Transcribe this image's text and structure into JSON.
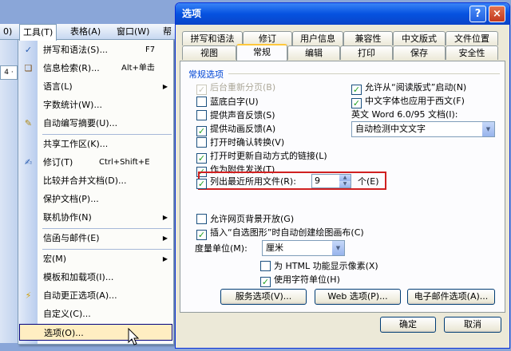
{
  "word": {
    "menubar": [
      {
        "label": "0)"
      },
      {
        "label": "工具(T)"
      },
      {
        "label": "表格(A)"
      },
      {
        "label": "窗口(W)"
      },
      {
        "label": "帮"
      }
    ],
    "toolbar_box": "4 ·"
  },
  "tools_menu": {
    "items": [
      {
        "label": "拼写和语法(S)...",
        "shortcut": "F7",
        "icon": "spelling-icon"
      },
      {
        "label": "信息检索(R)...",
        "shortcut": "Alt+单击",
        "icon": "research-icon"
      },
      {
        "label": "语言(L)",
        "submenu": true
      },
      {
        "label": "字数统计(W)..."
      },
      {
        "label": "自动编写摘要(U)...",
        "icon": "autosummarize-icon"
      },
      {
        "label": "共享工作区(K)..."
      },
      {
        "label": "修订(T)",
        "shortcut": "Ctrl+Shift+E",
        "icon": "track-changes-icon"
      },
      {
        "label": "比较并合并文档(D)..."
      },
      {
        "label": "保护文档(P)..."
      },
      {
        "label": "联机协作(N)",
        "submenu": true
      },
      {
        "label": "信函与邮件(E)",
        "submenu": true
      },
      {
        "label": "宏(M)",
        "submenu": true
      },
      {
        "label": "模板和加载项(I)..."
      },
      {
        "label": "自动更正选项(A)...",
        "icon": "autocorrect-icon"
      },
      {
        "label": "自定义(C)..."
      },
      {
        "label": "选项(O)..."
      }
    ]
  },
  "dialog": {
    "title": "选项",
    "help_label": "?",
    "close_label": "×",
    "tabs_row1": [
      "拼写和语法",
      "修订",
      "用户信息",
      "兼容性",
      "中文版式",
      "文件位置"
    ],
    "tabs_row2": [
      "视图",
      "常规",
      "编辑",
      "打印",
      "保存",
      "安全性"
    ],
    "selected_tab": "常规",
    "group_title": "常规选项",
    "left_options": [
      {
        "label": "后台重新分页(B)",
        "checked": true,
        "disabled": true
      },
      {
        "label": "蓝底白字(U)",
        "checked": false
      },
      {
        "label": "提供声音反馈(S)",
        "checked": false
      },
      {
        "label": "提供动画反馈(A)",
        "checked": true
      },
      {
        "label": "打开时确认转换(V)",
        "checked": false
      },
      {
        "label": "打开时更新自动方式的链接(L)",
        "checked": true
      },
      {
        "label": "作为附件发送(T)",
        "checked": true
      },
      {
        "label": "列出最近所用文件(R):",
        "checked": true
      }
    ],
    "recent_files_count": "9",
    "recent_files_unit": "个(E)",
    "right_options": [
      {
        "label": "允许从“阅读版式”启动(N)",
        "checked": true
      },
      {
        "label": "中文字体也应用于西文(F)",
        "checked": true
      }
    ],
    "word6_label": "英文 Word 6.0/95 文档(I):",
    "word6_value": "自动检测中文文字",
    "lower_options": [
      {
        "label": "允许网页背景开放(G)",
        "checked": false
      },
      {
        "label": "插入“自选图形”时自动创建绘图画布(C)",
        "checked": true
      }
    ],
    "unit_label": "度量单位(M):",
    "unit_value": "厘米",
    "html_pixels": {
      "label": "为 HTML 功能显示像素(X)",
      "checked": false
    },
    "char_units": {
      "label": "使用字符单位(H)",
      "checked": true
    },
    "buttons": {
      "service": "服务选项(V)...",
      "web": "Web 选项(P)...",
      "email": "电子邮件选项(A)...",
      "ok": "确定",
      "cancel": "取消"
    }
  }
}
